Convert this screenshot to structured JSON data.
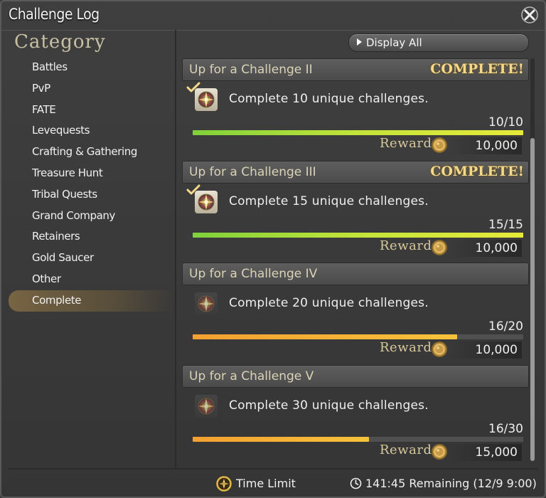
{
  "window": {
    "title": "Challenge Log"
  },
  "sidebar": {
    "heading": "Category",
    "items": [
      {
        "label": "Battles"
      },
      {
        "label": "PvP"
      },
      {
        "label": "FATE"
      },
      {
        "label": "Levequests"
      },
      {
        "label": "Crafting & Gathering"
      },
      {
        "label": "Treasure Hunt"
      },
      {
        "label": "Tribal Quests"
      },
      {
        "label": "Grand Company"
      },
      {
        "label": "Retainers"
      },
      {
        "label": "Gold Saucer"
      },
      {
        "label": "Other"
      },
      {
        "label": "Complete",
        "selected": true
      }
    ]
  },
  "display_all_label": "Display All",
  "entries": [
    {
      "title": "Up for a Challenge II",
      "status": "COMPLETE!",
      "completed": true,
      "description": "Complete 10 unique challenges.",
      "progress": "10/10",
      "progress_fraction": 1.0,
      "reward_label": "Reward",
      "reward_value": "10,000"
    },
    {
      "title": "Up for a Challenge III",
      "status": "COMPLETE!",
      "completed": true,
      "description": "Complete 15 unique challenges.",
      "progress": "15/15",
      "progress_fraction": 1.0,
      "reward_label": "Reward",
      "reward_value": "10,000"
    },
    {
      "title": "Up for a Challenge IV",
      "status": "",
      "completed": false,
      "description": "Complete 20 unique challenges.",
      "progress": "16/20",
      "progress_fraction": 0.8,
      "reward_label": "Reward",
      "reward_value": "10,000"
    },
    {
      "title": "Up for a Challenge V",
      "status": "",
      "completed": false,
      "description": "Complete 30 unique challenges.",
      "progress": "16/30",
      "progress_fraction": 0.533,
      "reward_label": "Reward",
      "reward_value": "15,000"
    }
  ],
  "footer": {
    "time_limit_label": "Time Limit",
    "remaining": "141:45 Remaining  (12/9 9:00)"
  },
  "icons": {
    "close": "close-icon",
    "display_all": "play-triangle-icon",
    "achievement": "compass-star-icon",
    "checkmark": "checkmark-icon",
    "coin": "gil-coin-icon",
    "time_limit": "compass-icon",
    "clock": "clock-icon"
  },
  "colors": {
    "background": "#3a3a3a",
    "entry_title": "#dbd3b6",
    "complete_text": "#f4d98a",
    "bar_complete": "#c4e43a",
    "bar_progress": "#f7c23b",
    "category_active": "#8c7346"
  }
}
